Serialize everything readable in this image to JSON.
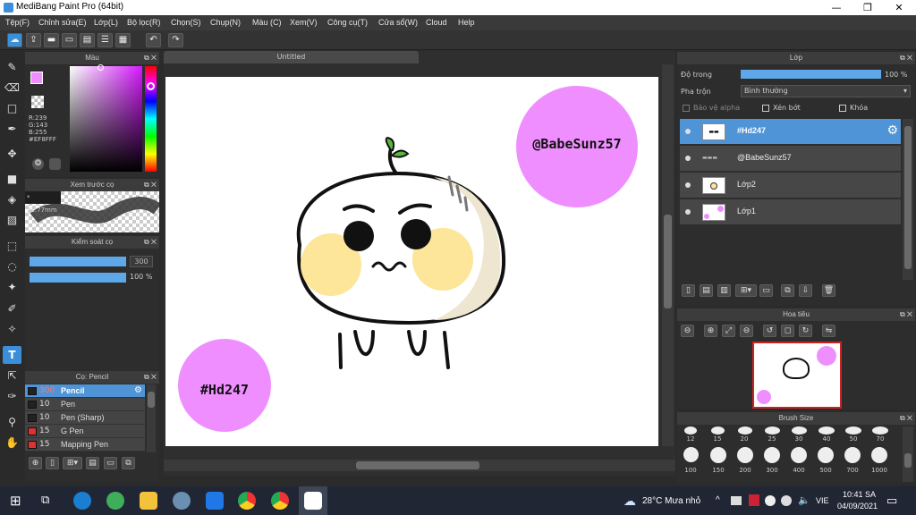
{
  "window": {
    "title": "MediBang Paint Pro (64bit)",
    "minimize": "—",
    "maximize": "❐",
    "close": "✕"
  },
  "menu": [
    "Tệp(F)",
    "Chỉnh sửa(E)",
    "Lớp(L)",
    "Bộ lọc(R)",
    "Chọn(S)",
    "Chụp(N)",
    "Màu (C)",
    "Xem(V)",
    "Công cụ(T)",
    "Cửa sổ(W)",
    "Cloud",
    "Help"
  ],
  "toolbar": {
    "undo": "↶",
    "redo": "↷"
  },
  "color_panel": {
    "title": "Màu",
    "r": "R:239",
    "g": "G:143",
    "b": "B:255",
    "hex": "#EF8FFF",
    "fg": "#EF8FFF"
  },
  "preview_panel": {
    "title": "Xem trước cọ",
    "size": "21.77mm"
  },
  "brush_ctrl": {
    "title": "Kiểm soát cọ",
    "size": "300",
    "opacity": "100 %"
  },
  "brush_panel": {
    "title": "Cọ: Pencil",
    "items": [
      {
        "size": "300",
        "name": "Pencil",
        "color": "#222222"
      },
      {
        "size": "10",
        "name": "Pen",
        "color": "#222222"
      },
      {
        "size": "10",
        "name": "Pen (Sharp)",
        "color": "#222222"
      },
      {
        "size": "15",
        "name": "G Pen",
        "color": "#e03030"
      },
      {
        "size": "15",
        "name": "Mapping Pen",
        "color": "#e03030"
      }
    ]
  },
  "document": {
    "tab": "Untitled"
  },
  "canvas": {
    "text_top": "@BabeSunz57",
    "text_bottom": "#Hd247",
    "circle_color": "#ef8fff",
    "cheek_color": "#fde59a"
  },
  "layer_panel": {
    "title": "Lớp",
    "opacity_label": "Độ trong",
    "opacity_value": "100 %",
    "blend_label": "Pha trộn",
    "blend_value": "Bình thường",
    "protect_alpha": "Bảo vệ alpha",
    "clip": "Xén bớt",
    "lock": "Khóa",
    "layers": [
      {
        "name": "#Hd247",
        "selected": true
      },
      {
        "name": "@BabeSunz57",
        "selected": false
      },
      {
        "name": "Lớp2",
        "selected": false
      },
      {
        "name": "Lớp1",
        "selected": false
      }
    ]
  },
  "navigator": {
    "title": "Hoa tiêu"
  },
  "brush_size": {
    "title": "Brush Size",
    "row1": [
      "12",
      "15",
      "20",
      "25",
      "30",
      "40",
      "50",
      "70"
    ],
    "row2": [
      "100",
      "150",
      "200",
      "300",
      "400",
      "500",
      "700",
      "1000"
    ]
  },
  "taskbar": {
    "weather": "28°C  Mưa nhỏ",
    "lang": "VIE",
    "time": "10:41 SA",
    "date": "04/09/2021"
  }
}
